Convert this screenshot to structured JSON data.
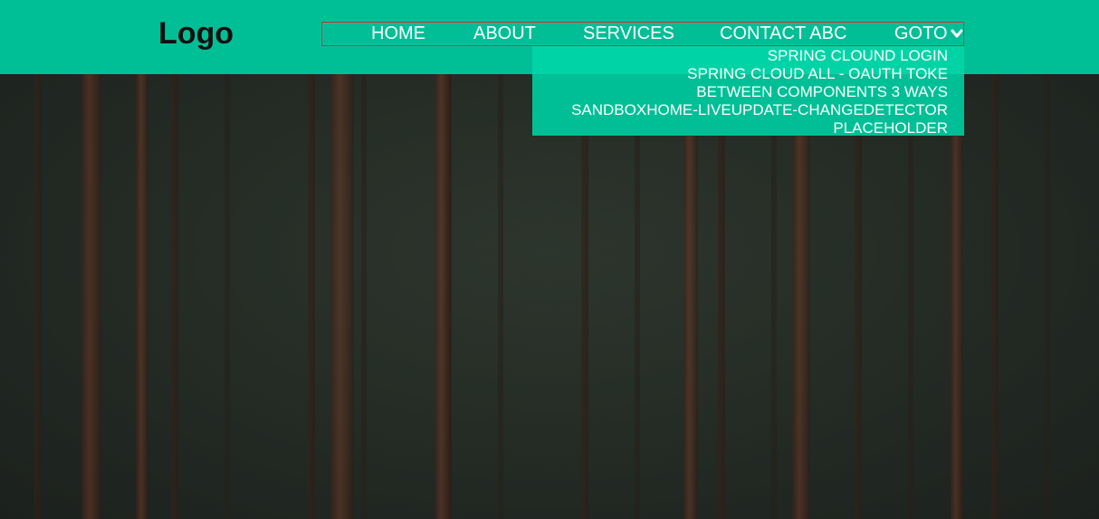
{
  "brand": {
    "logo": "Logo"
  },
  "nav": {
    "items": [
      {
        "label": "HOME"
      },
      {
        "label": "ABOUT"
      },
      {
        "label": "SERVICES"
      },
      {
        "label": "CONTACT ABC"
      },
      {
        "label": "GOTO",
        "icon": "chevron-down-icon"
      }
    ]
  },
  "dropdown": {
    "items": [
      {
        "label": "SPRING CLOUND LOGIN"
      },
      {
        "label": "SPRING CLOUD ALL - OAUTH TOKE"
      },
      {
        "label": "BETWEEN COMPONENTS 3 WAYS"
      },
      {
        "label": "SANDBOXHOME-LIVEUPDATE-CHANGEDETECTOR"
      },
      {
        "label": "PLACEHOLDER"
      }
    ]
  },
  "colors": {
    "navbar": "#00bf96",
    "dropdown_highlight": "#00d4a6",
    "nav_border": "#c0392b",
    "logo": "#111111",
    "nav_text": "#ffffff"
  }
}
